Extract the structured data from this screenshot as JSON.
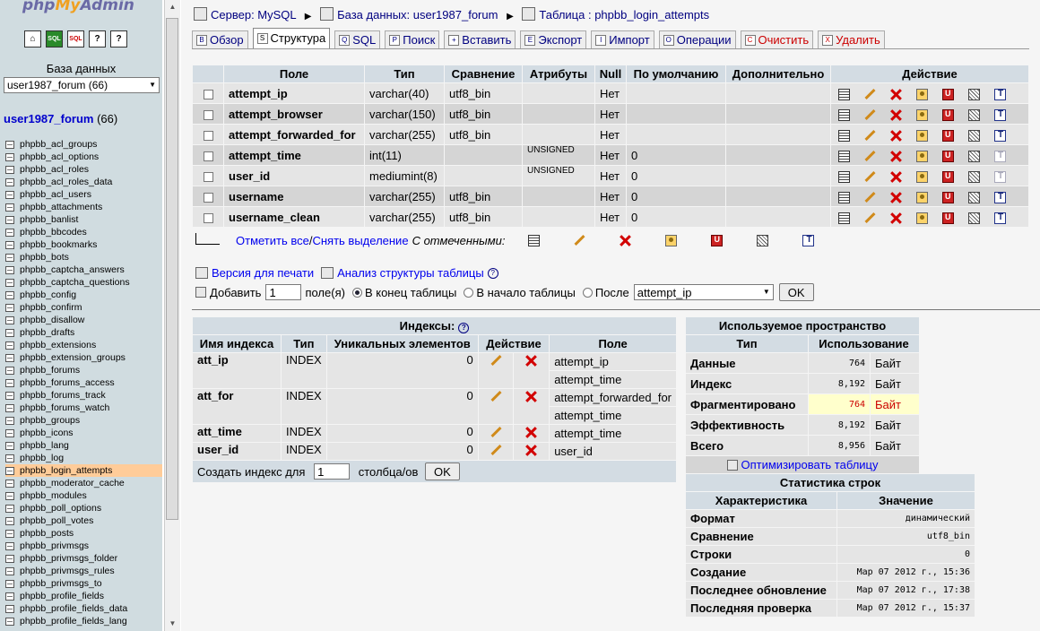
{
  "nav": {
    "logo": {
      "php": "php",
      "my": "My",
      "admin": "Admin"
    },
    "icons": [
      "home-icon",
      "sql-icon",
      "sql-query-icon",
      "docs-icon",
      "docs-icon-2"
    ],
    "db_label": "База данных",
    "db_select": "user1987_forum (66)",
    "db_title": "user1987_forum",
    "db_count": "(66)",
    "tables": [
      "phpbb_acl_groups",
      "phpbb_acl_options",
      "phpbb_acl_roles",
      "phpbb_acl_roles_data",
      "phpbb_acl_users",
      "phpbb_attachments",
      "phpbb_banlist",
      "phpbb_bbcodes",
      "phpbb_bookmarks",
      "phpbb_bots",
      "phpbb_captcha_answers",
      "phpbb_captcha_questions",
      "phpbb_config",
      "phpbb_confirm",
      "phpbb_disallow",
      "phpbb_drafts",
      "phpbb_extensions",
      "phpbb_extension_groups",
      "phpbb_forums",
      "phpbb_forums_access",
      "phpbb_forums_track",
      "phpbb_forums_watch",
      "phpbb_groups",
      "phpbb_icons",
      "phpbb_lang",
      "phpbb_log",
      "phpbb_login_attempts",
      "phpbb_moderator_cache",
      "phpbb_modules",
      "phpbb_poll_options",
      "phpbb_poll_votes",
      "phpbb_posts",
      "phpbb_privmsgs",
      "phpbb_privmsgs_folder",
      "phpbb_privmsgs_rules",
      "phpbb_privmsgs_to",
      "phpbb_profile_fields",
      "phpbb_profile_fields_data",
      "phpbb_profile_fields_lang"
    ],
    "active_table": "phpbb_login_attempts"
  },
  "breadcrumb": {
    "server": "Сервер: MySQL",
    "database": "База данных: user1987_forum",
    "table": "Таблица : phpbb_login_attempts"
  },
  "tabs": [
    {
      "label": "Обзор",
      "icon": "B"
    },
    {
      "label": "Структура",
      "icon": "S",
      "active": true
    },
    {
      "label": "SQL",
      "icon": "Q"
    },
    {
      "label": "Поиск",
      "icon": "P"
    },
    {
      "label": "Вставить",
      "icon": "+"
    },
    {
      "label": "Экспорт",
      "icon": "E"
    },
    {
      "label": "Импорт",
      "icon": "I"
    },
    {
      "label": "Операции",
      "icon": "O"
    },
    {
      "label": "Очистить",
      "icon": "C",
      "warn": true
    },
    {
      "label": "Удалить",
      "icon": "X",
      "warn": true
    }
  ],
  "structure": {
    "headers": {
      "field": "Поле",
      "type": "Тип",
      "collation": "Сравнение",
      "attributes": "Атрибуты",
      "null": "Null",
      "default": "По умолчанию",
      "extra": "Дополнительно",
      "action": "Действие"
    },
    "rows": [
      {
        "field": "attempt_ip",
        "type": "varchar(40)",
        "collation": "utf8_bin",
        "attributes": "",
        "null": "Нет",
        "default": "",
        "extra": ""
      },
      {
        "field": "attempt_browser",
        "type": "varchar(150)",
        "collation": "utf8_bin",
        "attributes": "",
        "null": "Нет",
        "default": "",
        "extra": ""
      },
      {
        "field": "attempt_forwarded_for",
        "type": "varchar(255)",
        "collation": "utf8_bin",
        "attributes": "",
        "null": "Нет",
        "default": "",
        "extra": ""
      },
      {
        "field": "attempt_time",
        "type": "int(11)",
        "collation": "",
        "attributes": "UNSIGNED",
        "null": "Нет",
        "default": "0",
        "extra": ""
      },
      {
        "field": "user_id",
        "type": "mediumint(8)",
        "collation": "",
        "attributes": "UNSIGNED",
        "null": "Нет",
        "default": "0",
        "extra": ""
      },
      {
        "field": "username",
        "type": "varchar(255)",
        "collation": "utf8_bin",
        "attributes": "",
        "null": "Нет",
        "default": "0",
        "extra": ""
      },
      {
        "field": "username_clean",
        "type": "varchar(255)",
        "collation": "utf8_bin",
        "attributes": "",
        "null": "Нет",
        "default": "0",
        "extra": ""
      }
    ],
    "fulltext_dim": [
      false,
      false,
      false,
      true,
      true,
      false,
      false
    ],
    "check_all": "Отметить все",
    "separator": " / ",
    "uncheck_all": "Снять выделение",
    "with_selected": "С отмеченными:"
  },
  "print_view": "Версия для печати",
  "propose_structure": "Анализ структуры таблицы",
  "add_fields": {
    "label": "Добавить",
    "count": "1",
    "suffix": "поле(я)",
    "at_end": "В конец таблицы",
    "at_begin": "В начало таблицы",
    "after": "После",
    "after_field": "attempt_ip",
    "go": "OK"
  },
  "indexes": {
    "title": "Индексы:",
    "headers": {
      "name": "Имя индекса",
      "type": "Тип",
      "cardinality": "Уникальных элементов",
      "action": "Действие",
      "field": "Поле"
    },
    "rows": [
      {
        "name": "att_ip",
        "type": "INDEX",
        "cardinality": "0",
        "fields": [
          "attempt_ip",
          "attempt_time"
        ]
      },
      {
        "name": "att_for",
        "type": "INDEX",
        "cardinality": "0",
        "fields": [
          "attempt_forwarded_for",
          "attempt_time"
        ]
      },
      {
        "name": "att_time",
        "type": "INDEX",
        "cardinality": "0",
        "fields": [
          "attempt_time"
        ]
      },
      {
        "name": "user_id",
        "type": "INDEX",
        "cardinality": "0",
        "fields": [
          "user_id"
        ]
      }
    ],
    "create_label": "Создать индекс для",
    "create_count": "1",
    "create_suffix": "столбца/ов",
    "go": "OK"
  },
  "space": {
    "title": "Используемое пространство",
    "headers": {
      "type": "Тип",
      "usage": "Использование"
    },
    "rows": [
      {
        "label": "Данные",
        "value": "764",
        "unit": "Байт"
      },
      {
        "label": "Индекс",
        "value": "8,192",
        "unit": "Байт"
      },
      {
        "label": "Фрагментировано",
        "value": "764",
        "unit": "Байт",
        "warn": true
      },
      {
        "label": "Эффективность",
        "value": "8,192",
        "unit": "Байт"
      },
      {
        "label": "Всего",
        "value": "8,956",
        "unit": "Байт"
      }
    ],
    "optimize": "Оптимизировать таблицу",
    "highlight_color": "#ffffcc",
    "warn_text_color": "#cc0000"
  },
  "row_stats": {
    "title": "Статистика строк",
    "headers": {
      "stat": "Характеристика",
      "value": "Значение"
    },
    "rows": [
      {
        "label": "Формат",
        "value": "динамический"
      },
      {
        "label": "Сравнение",
        "value": "utf8_bin"
      },
      {
        "label": "Строки",
        "value": "0"
      },
      {
        "label": "Создание",
        "value": "Мар 07 2012 г., 15:36"
      },
      {
        "label": "Последнее обновление",
        "value": "Мар 07 2012 г., 17:38"
      },
      {
        "label": "Последняя проверка",
        "value": "Мар 07 2012 г., 15:37"
      }
    ]
  }
}
